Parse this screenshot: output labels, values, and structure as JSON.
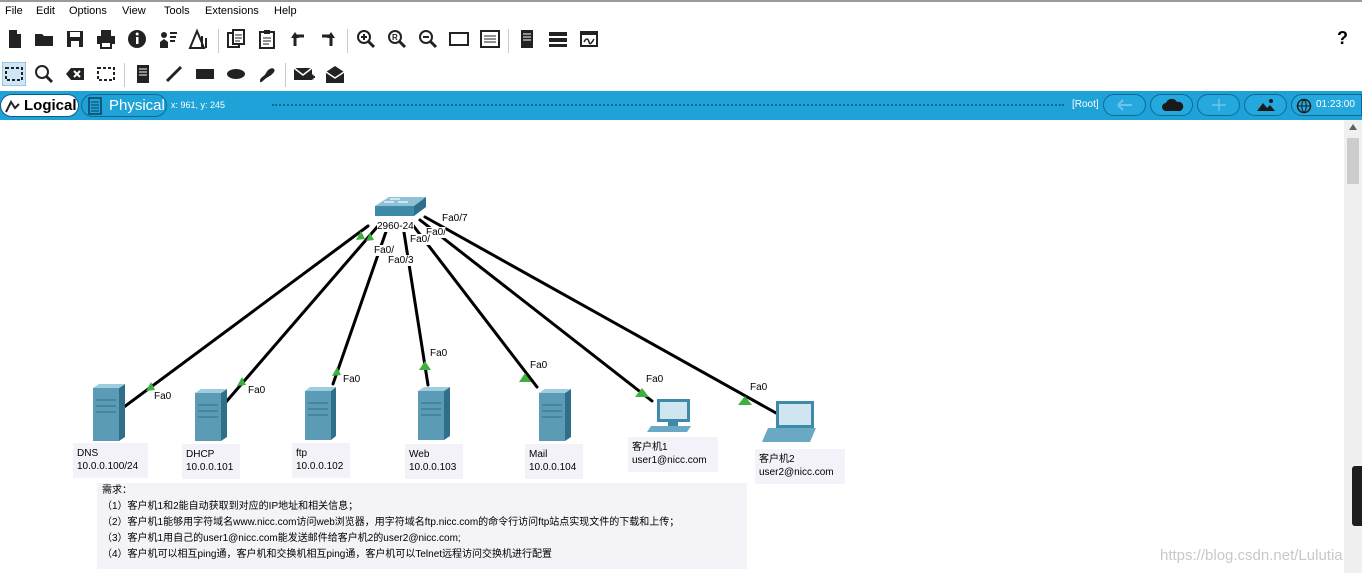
{
  "menu": [
    "File",
    "Edit",
    "Options",
    "View",
    "Tools",
    "Extensions",
    "Help"
  ],
  "toolbar": {
    "main_icons": [
      "new-file-icon",
      "open-folder-icon",
      "save-icon",
      "print-icon",
      "info-icon",
      "activity-wizard-icon",
      "pdu-icon",
      "copy-icon",
      "paste-icon",
      "undo-icon",
      "redo-icon",
      "zoom-in-icon",
      "zoom-reset-icon",
      "zoom-out-icon",
      "drawing-palette-icon",
      "custom-devices-icon",
      "notes-icon",
      "cluster-icon",
      "pdu-list-icon"
    ],
    "help_label": "?",
    "edit_icons": [
      "select-icon",
      "inspect-icon",
      "delete-icon",
      "resize-icon",
      "place-note-icon",
      "draw-line-icon",
      "draw-rectangle-icon",
      "draw-ellipse-icon",
      "freeform-icon",
      "add-simple-pdu-icon",
      "add-complex-pdu-icon"
    ]
  },
  "workspace": {
    "logical_label": "Logical",
    "physical_label": "Physical",
    "coords": "x: 961, y: 245",
    "root_label": "[Root]",
    "time": "01:23:00"
  },
  "switch": {
    "name": "2960-24",
    "ports": [
      "Fa0/7",
      "Fa0/3",
      "Fa0/",
      "Fa0/",
      "Fa0/",
      "Fa0/"
    ]
  },
  "devices": [
    {
      "name": "DNS",
      "ip": "10.0.0.100/24",
      "port": "Fa0"
    },
    {
      "name": "DHCP",
      "ip": "10.0.0.101",
      "port": "Fa0"
    },
    {
      "name": "ftp",
      "ip": "10.0.0.102",
      "port": "Fa0"
    },
    {
      "name": "Web",
      "ip": "10.0.0.103",
      "port": "Fa0"
    },
    {
      "name": "Mail",
      "ip": "10.0.0.104",
      "port": "Fa0"
    },
    {
      "name": "客户机1",
      "ip": "user1@nicc.com",
      "port": "Fa0"
    },
    {
      "name": "客户机2",
      "ip": "user2@nicc.com",
      "port": "Fa0"
    }
  ],
  "notes": [
    "需求：",
    "（1）客户机1和2能自动获取到对应的IP地址和相关信息；",
    "（2）客户机1能够用字符域名www.nicc.com访问web浏览器，用字符域名ftp.nicc.com的命令行访问ftp站点实现文件的下载和上传；",
    "（3）客户机1用自己的user1@nicc.com能发送邮件给客户机2的user2@nicc.com;",
    "（4）客户机可以相互ping通，客户机和交换机相互ping通，客户机可以Telnet远程访问交换机进行配置"
  ],
  "watermark": "https://blog.csdn.net/Lulutia",
  "colors": {
    "workspace_bar": "#1fa2d8",
    "link": "#000000",
    "port_up": "#3db03d",
    "device": "#4a90a8"
  }
}
